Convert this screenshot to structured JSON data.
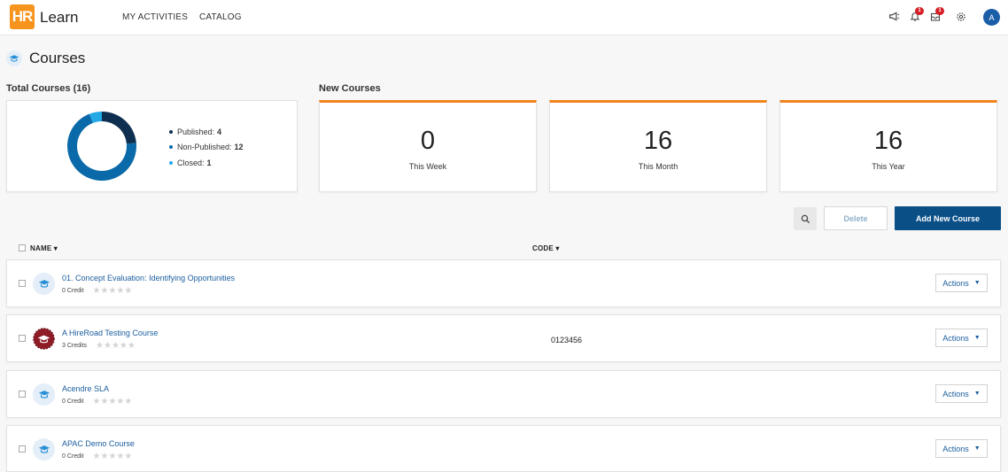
{
  "header": {
    "logo_text": "HR",
    "app_name": "Learn",
    "nav": [
      "MY ACTIVITIES",
      "CATALOG"
    ],
    "notification_count": "1",
    "messages_count": "1",
    "avatar_initial": "A",
    "icons": [
      "megaphone-icon",
      "bell-icon",
      "inbox-icon",
      "gear-icon"
    ]
  },
  "page": {
    "title": "Courses",
    "total_label": "Total Courses (16)",
    "new_label": "New Courses"
  },
  "donut": {
    "legend": [
      {
        "label": "Published:",
        "value": "4",
        "color": "#0e2f4f"
      },
      {
        "label": "Non-Published:",
        "value": "12",
        "color": "#0a69a8"
      },
      {
        "label": "Closed:",
        "value": "1",
        "color": "#22a9e6"
      }
    ]
  },
  "stats": [
    {
      "value": "0",
      "label": "This Week"
    },
    {
      "value": "16",
      "label": "This Month"
    },
    {
      "value": "16",
      "label": "This Year"
    }
  ],
  "toolbar": {
    "delete_label": "Delete",
    "add_label": "Add New Course"
  },
  "table": {
    "columns": [
      "NAME ▾",
      "CODE ▾"
    ],
    "rows": [
      {
        "title": "01. Concept Evaluation: Identifying Opportunities",
        "credits": "0 Credit",
        "code": "",
        "icon": "course-cap-icon",
        "rating": 0
      },
      {
        "title": "A HireRoad Testing Course",
        "credits": "3 Credits",
        "code": "0123456",
        "icon": "course-seal-icon",
        "rating": 0
      },
      {
        "title": "Acendre SLA",
        "credits": "0 Credit",
        "code": "",
        "icon": "course-cap-icon",
        "rating": 0
      },
      {
        "title": "APAC Demo Course",
        "credits": "0 Credit",
        "code": "",
        "icon": "course-cap-icon",
        "rating": 0
      }
    ],
    "actions_label": "Actions",
    "stars": "★★★★★"
  }
}
